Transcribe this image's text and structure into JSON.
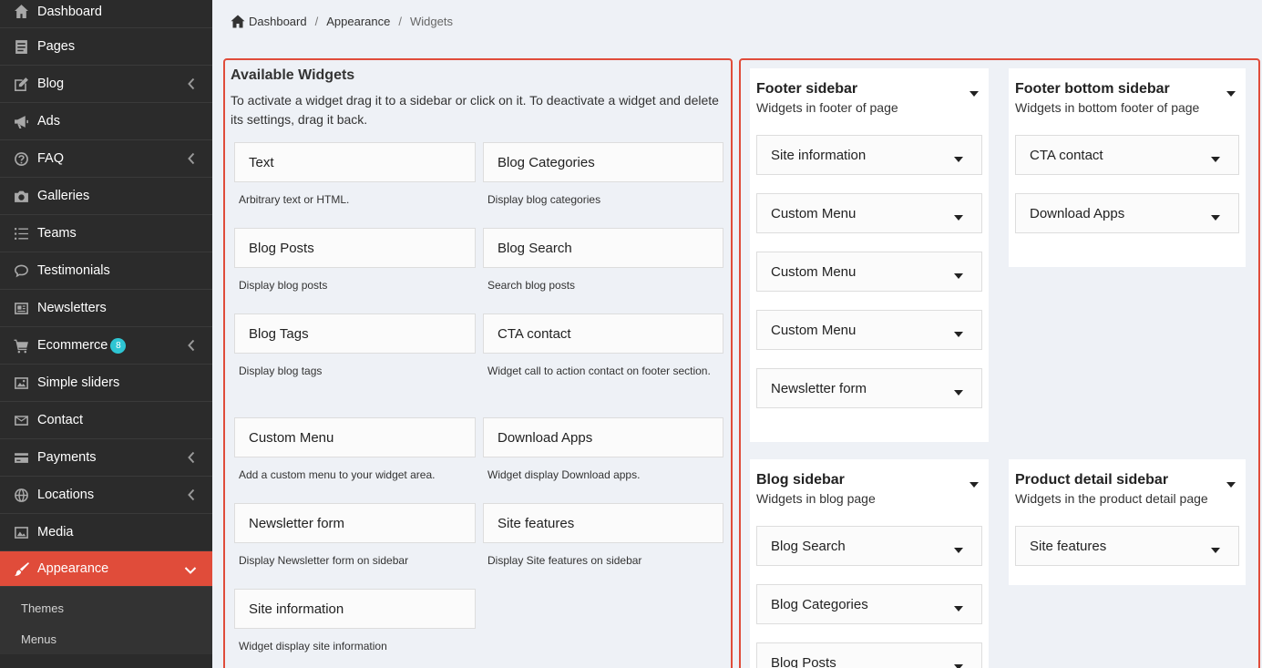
{
  "sidebar": {
    "items": [
      {
        "label": "Dashboard",
        "icon": "home-icon",
        "chevron": false
      },
      {
        "label": "Pages",
        "icon": "pages-icon",
        "chevron": false
      },
      {
        "label": "Blog",
        "icon": "edit-icon",
        "chevron": true
      },
      {
        "label": "Ads",
        "icon": "megaphone-icon",
        "chevron": false
      },
      {
        "label": "FAQ",
        "icon": "question-icon",
        "chevron": true
      },
      {
        "label": "Galleries",
        "icon": "camera-icon",
        "chevron": false
      },
      {
        "label": "Teams",
        "icon": "list-icon",
        "chevron": false
      },
      {
        "label": "Testimonials",
        "icon": "comment-icon",
        "chevron": false
      },
      {
        "label": "Newsletters",
        "icon": "newspaper-icon",
        "chevron": false
      },
      {
        "label": "Ecommerce",
        "icon": "cart-icon",
        "chevron": true,
        "badge": "8"
      },
      {
        "label": "Simple sliders",
        "icon": "image-icon",
        "chevron": false
      },
      {
        "label": "Contact",
        "icon": "envelope-icon",
        "chevron": false
      },
      {
        "label": "Payments",
        "icon": "credit-card-icon",
        "chevron": true
      },
      {
        "label": "Locations",
        "icon": "globe-icon",
        "chevron": true
      },
      {
        "label": "Media",
        "icon": "media-icon",
        "chevron": false
      },
      {
        "label": "Appearance",
        "icon": "brush-icon",
        "chevron": true,
        "active": true
      }
    ],
    "sub_items": [
      "Themes",
      "Menus"
    ]
  },
  "breadcrumb": {
    "home": "Dashboard",
    "parent": "Appearance",
    "current": "Widgets",
    "separator": "/"
  },
  "available": {
    "title": "Available Widgets",
    "description": "To activate a widget drag it to a sidebar or click on it. To deactivate a widget and delete its settings, drag it back.",
    "widgets": [
      {
        "name": "Text",
        "desc": "Arbitrary text or HTML."
      },
      {
        "name": "Blog Categories",
        "desc": "Display blog categories"
      },
      {
        "name": "Blog Posts",
        "desc": "Display blog posts"
      },
      {
        "name": "Blog Search",
        "desc": "Search blog posts"
      },
      {
        "name": "Blog Tags",
        "desc": "Display blog tags"
      },
      {
        "name": "CTA contact",
        "desc": "Widget call to action contact on footer section."
      },
      {
        "name": "Custom Menu",
        "desc": "Add a custom menu to your widget area."
      },
      {
        "name": "Download Apps",
        "desc": "Widget display Download apps."
      },
      {
        "name": "Newsletter form",
        "desc": "Display Newsletter form on sidebar"
      },
      {
        "name": "Site features",
        "desc": "Display Site features on sidebar"
      },
      {
        "name": "Site information",
        "desc": "Widget display site information"
      }
    ]
  },
  "sidebars": {
    "footer": {
      "title": "Footer sidebar",
      "subtitle": "Widgets in footer of page",
      "items": [
        "Site information",
        "Custom Menu",
        "Custom Menu",
        "Custom Menu",
        "Newsletter form"
      ]
    },
    "footer_bottom": {
      "title": "Footer bottom sidebar",
      "subtitle": "Widgets in bottom footer of page",
      "items": [
        "CTA contact",
        "Download Apps"
      ]
    },
    "blog": {
      "title": "Blog sidebar",
      "subtitle": "Widgets in blog page",
      "items": [
        "Blog Search",
        "Blog Categories",
        "Blog Posts"
      ]
    },
    "product_detail": {
      "title": "Product detail sidebar",
      "subtitle": "Widgets in the product detail page",
      "items": [
        "Site features"
      ]
    }
  },
  "colors": {
    "accent": "#e04c3a",
    "sidebar_bg": "#2b2b2b",
    "badge": "#2ec5d3",
    "page_bg": "#eef1f6"
  }
}
